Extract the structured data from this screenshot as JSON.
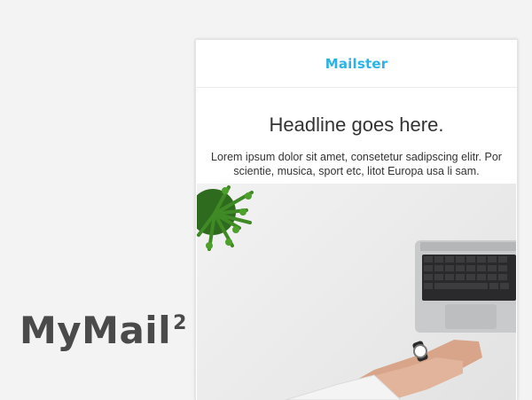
{
  "brand": {
    "name": "MyMail",
    "superscript": "2"
  },
  "email": {
    "logo": "Mailster",
    "headline": "Headline goes here.",
    "body": "Lorem ipsum dolor sit amet, consetetur sadipscing elitr. Por scientie, musica, sport etc, litot Europa usa li sam.",
    "hero_image": "desk-laptop-plant-photo"
  },
  "colors": {
    "accent": "#2bb3e8",
    "brand_text": "#4a4a4a",
    "background": "#f3f3f3"
  }
}
